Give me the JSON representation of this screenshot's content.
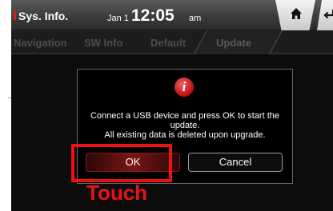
{
  "header": {
    "title": "Sys. Info.",
    "date": "Jan 1",
    "time": "12:05",
    "ampm": "am"
  },
  "tabs": [
    "Navigation",
    "SW Info",
    "Default",
    "Update"
  ],
  "dialog": {
    "line1": "Connect a USB device and press OK to start the",
    "line2": "update.",
    "line3": "All existing data is deleted upon upgrade.",
    "ok_label": "OK",
    "cancel_label": "Cancel"
  },
  "annotation": {
    "label": "Touch",
    "color": "#ee1111"
  },
  "colors": {
    "accent": "#d61f1f"
  }
}
